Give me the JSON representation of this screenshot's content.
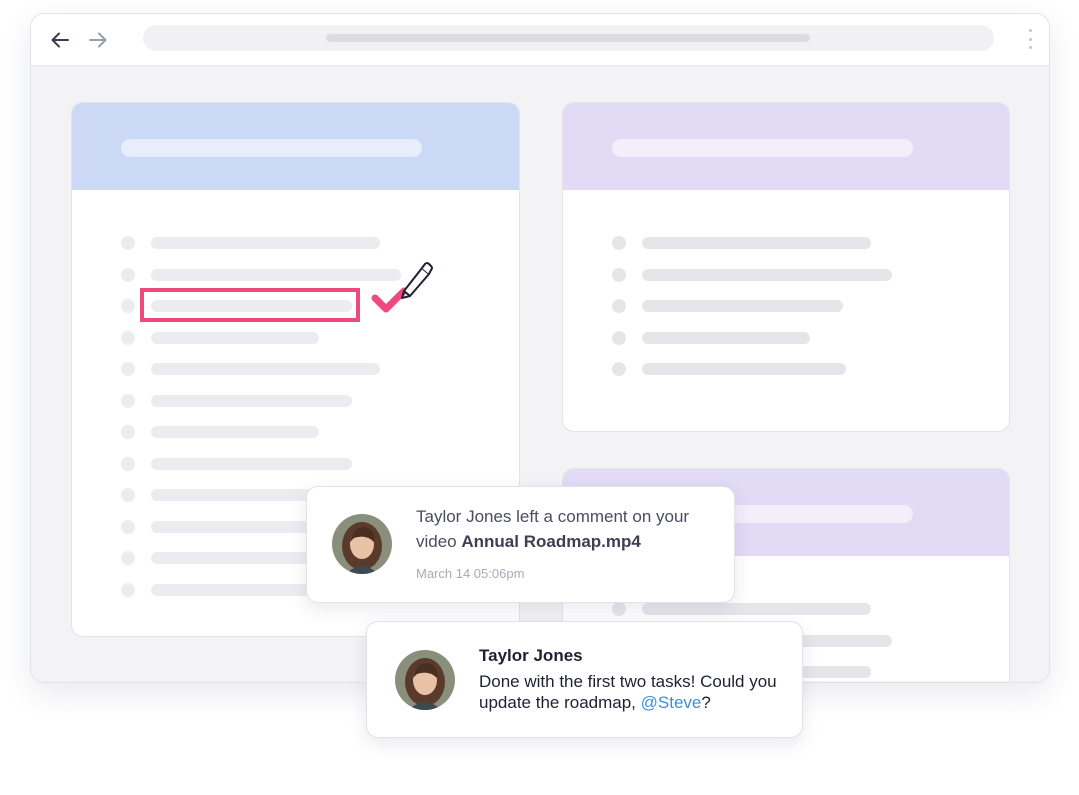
{
  "browser": {
    "back_icon": "arrow-left-icon",
    "forward_icon": "arrow-right-icon",
    "menu_icon": "kebab-menu-icon"
  },
  "cards": {
    "left_accent": "#cbd8f6",
    "right_accent": "#e2dbf6",
    "left_rows": 12,
    "highlighted_row": 3
  },
  "annotation": {
    "highlight_color": "#ee4a7e",
    "check_icon": "checkmark-icon",
    "pencil_icon": "pencil-icon"
  },
  "notification": {
    "text_prefix": "Taylor Jones left a comment on your video ",
    "filename": "Annual Roadmap.mp4",
    "time": "March 14 05:06pm",
    "avatar_icon": "avatar"
  },
  "comment": {
    "author": "Taylor Jones",
    "text_before": "Done with the first two tasks! Could you update the roadmap, ",
    "mention": "@Steve",
    "text_after": "?",
    "mention_color": "#3f8fd2",
    "avatar_icon": "avatar"
  }
}
